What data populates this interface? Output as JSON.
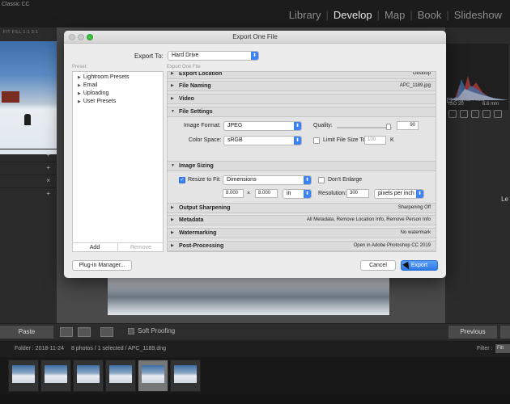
{
  "app": {
    "title": "Classic CC"
  },
  "modules": [
    "Library",
    "Develop",
    "Map",
    "Book",
    "Slideshow"
  ],
  "active_module": "Develop",
  "left_panel": {
    "nav_tabs": "FIT  FILL  1:1  3:1",
    "rows_plus": [
      "+",
      "+",
      "+",
      "×",
      "+"
    ]
  },
  "right_panel": {
    "iso": "ISO 20",
    "focal": "6.6 mm",
    "original_photo": "Original Photo",
    "le": "Le"
  },
  "toolbar": {
    "paste": "Paste",
    "soft_proofing": "Soft Proofing",
    "previous": "Previous"
  },
  "filmstrip": {
    "folder": "Folder : 2018-11-24",
    "count": "8 photos / 1 selected / APC_1189.dng",
    "filter_label": "Filter :",
    "filter_value": "Filt"
  },
  "dialog": {
    "title": "Export One File",
    "export_to_label": "Export To:",
    "export_to_value": "Hard Drive",
    "preset_label": "Preset:",
    "export_one_file_label": "Export One File",
    "presets": [
      "Lightroom Presets",
      "Email",
      "Uploading",
      "User Presets"
    ],
    "add_label": "Add",
    "remove_label": "Remove",
    "sections": {
      "export_location": {
        "name": "Export Location",
        "summary": "Desktop"
      },
      "file_naming": {
        "name": "File Naming",
        "summary": "APC_1189.jpg"
      },
      "video": {
        "name": "Video",
        "summary": ""
      },
      "file_settings": {
        "name": "File Settings",
        "image_format_label": "Image Format:",
        "image_format_value": "JPEG",
        "quality_label": "Quality:",
        "quality_value": "90",
        "color_space_label": "Color Space:",
        "color_space_value": "sRGB",
        "limit_file_size_label": "Limit File Size To:",
        "limit_file_size_value": "100",
        "limit_unit": "K"
      },
      "image_sizing": {
        "name": "Image Sizing",
        "resize_label": "Resize to Fit:",
        "resize_value": "Dimensions",
        "dont_enlarge": "Don't Enlarge",
        "width": "8.000",
        "times": "×",
        "height": "8.000",
        "unit": "in",
        "resolution_label": "Resolution:",
        "resolution_value": "300",
        "resolution_unit": "pixels per inch"
      },
      "output_sharpening": {
        "name": "Output Sharpening",
        "summary": "Sharpening Off"
      },
      "metadata": {
        "name": "Metadata",
        "summary": "All Metadata, Remove Location Info, Remove Person Info"
      },
      "watermarking": {
        "name": "Watermarking",
        "summary": "No watermark"
      },
      "post_processing": {
        "name": "Post-Processing",
        "summary": "Open in Adobe Photoshop CC 2019"
      }
    },
    "plugin_manager": "Plug-in Manager...",
    "cancel": "Cancel",
    "export": "Export"
  },
  "colors": {
    "accent": "#3b82f6",
    "export_button": "#2f79e8",
    "traffic_green": "#3dc23f"
  }
}
